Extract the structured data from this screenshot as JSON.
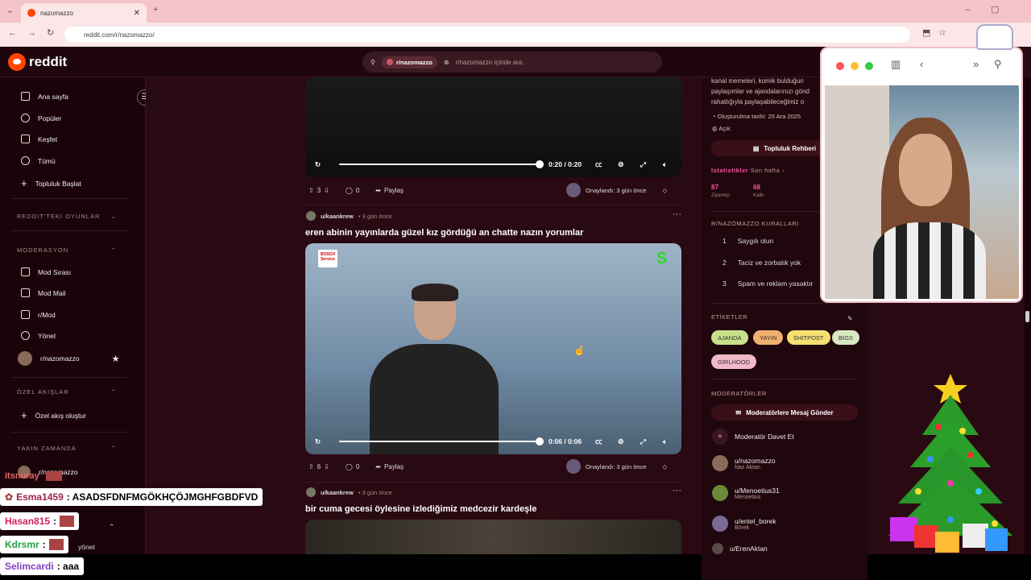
{
  "browser": {
    "tab_title": "nazomazzo",
    "url": "reddit.com/r/nazomazzo/"
  },
  "header": {
    "logo_text": "reddit",
    "search_chip": "r/nazomazzo",
    "search_placeholder": "r/nazomazzo içinde ara"
  },
  "sidebar": {
    "items": [
      {
        "label": "Ana sayfa",
        "icon": "home-icon"
      },
      {
        "label": "Popüler",
        "icon": "popular-icon"
      },
      {
        "label": "Keşfet",
        "icon": "explore-icon"
      },
      {
        "label": "Tümü",
        "icon": "all-icon"
      },
      {
        "label": "Topluluk Başlat",
        "icon": "plus-icon"
      }
    ],
    "section_games": "REDDIT'TEKİ OYUNLAR",
    "section_moderation": "MODERASYON",
    "mod_items": [
      {
        "label": "Mod Sırası",
        "icon": "queue-icon"
      },
      {
        "label": "Mod Mail",
        "icon": "mail-icon"
      },
      {
        "label": "r/Mod",
        "icon": "mod-icon"
      },
      {
        "label": "Yönet",
        "icon": "settings-icon"
      },
      {
        "label": "r/nazomazzo",
        "icon": "avatar-icon"
      }
    ],
    "section_custom": "ÖZEL AKIŞLAR",
    "create_custom": "Özel akış oluştur",
    "section_recent": "YAKIN ZAMANDA",
    "recent_item": "r/nazomazzo",
    "partial_item": "yönet"
  },
  "posts": [
    {
      "time": "0:20 / 0:20",
      "votes": "3",
      "comments": "0",
      "share": "Paylaş",
      "approved": "Onaylandı: 3 gün önce"
    },
    {
      "user": "u/kaankrew",
      "age": "• 3 gün önce",
      "title": "eren abinin yayınlarda güzel kız gördüğü an chatte nazın yorumlar",
      "time": "0:06 / 0:06",
      "votes": "6",
      "comments": "0",
      "share": "Paylaş",
      "approved": "Onaylandı: 3 gün önce",
      "badge": "BOSCH Service"
    },
    {
      "user": "u/kaankrew",
      "age": "• 3 gün önce",
      "title": "bir cuma gecesi öylesine izlediğimiz medcezir kardeşle"
    }
  ],
  "right": {
    "desc_lines": [
      "kanal memeleri, komik bulduğun",
      "paylaşımlar ve ajandalarınızı gönd",
      "rahatlığıyla paylaşabileceğimiz o"
    ],
    "created": "Oluşturulma tarihi: 25 Ara 2025",
    "public": "Açık",
    "guide_btn": "Topluluk Rehberi",
    "stats_label": "İstatistikler",
    "stats_range": "Son hafta",
    "visits": "87",
    "visits_label": "Ziyaretçi",
    "contrib": "68",
    "contrib_label": "Katkı",
    "rules_label": "R/NAZOMAZZO KURALLARI",
    "rules": [
      {
        "n": "1",
        "t": "Saygılı olun"
      },
      {
        "n": "2",
        "t": "Taciz ve zorbalık yok"
      },
      {
        "n": "3",
        "t": "Spam ve reklam yasaktır"
      }
    ],
    "tags_label": "ETİKETLER",
    "tags": [
      {
        "t": "AJANDA",
        "c": "#c8e08a"
      },
      {
        "t": "YAYIN",
        "c": "#f0b070"
      },
      {
        "t": "SHITPOST",
        "c": "#f5e070"
      },
      {
        "t": "BIGS",
        "c": "#d8e8c0"
      },
      {
        "t": "GIRLHOOD",
        "c": "#f0b8c8"
      }
    ],
    "mods_label": "MODERATÖRLER",
    "msg_btn": "Moderatörlere Mesaj Gönder",
    "invite": "Moderatör Davet Et",
    "mods": [
      {
        "n": "u/nazomazzo",
        "s": "Naz Aktan",
        "c": "#8a6a5a"
      },
      {
        "n": "u/Menoetius31",
        "s": "Menoetius",
        "c": "#6a8a3a"
      },
      {
        "n": "u/entel_borek",
        "s": "Börek",
        "c": "#7a6a9a"
      },
      {
        "n": "u/ErenAktan",
        "s": "",
        "c": "#5a4a4a"
      }
    ]
  },
  "chat": [
    {
      "name": "itsnuray",
      "msg": "",
      "color": "#c03030"
    },
    {
      "name": "Esma1459",
      "msg": ": ASADSFDNFMGÖKHÇÖJMGHFGBDFVD",
      "color": "#a02050"
    },
    {
      "name": "Hasan815",
      "msg": ":",
      "color": "#d02060"
    },
    {
      "name": "Kdrsmr",
      "msg": ":",
      "color": "#20a040"
    },
    {
      "name": "Selimcardi",
      "msg": ": aaa",
      "color": "#8040c0"
    }
  ],
  "colors": {
    "accent": "#ff4500",
    "bg": "#2a0a12"
  }
}
